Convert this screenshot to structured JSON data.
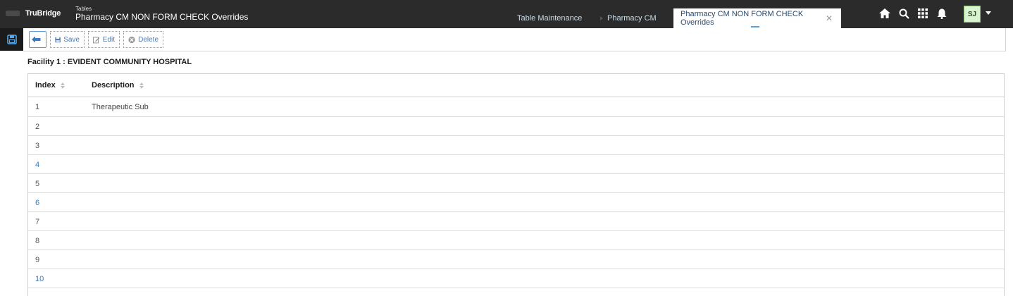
{
  "header": {
    "logo_text": "TruBridge",
    "subtitle": "Tables",
    "title": "Pharmacy CM NON FORM CHECK Overrides",
    "tabs": [
      {
        "label": "Table Maintenance"
      },
      {
        "label": "Pharmacy CM"
      },
      {
        "label": "Pharmacy CM NON FORM CHECK Overrides"
      }
    ],
    "avatar_initials": "SJ"
  },
  "toolbar": {
    "save_label": "Save",
    "edit_label": "Edit",
    "delete_label": "Delete"
  },
  "facility": {
    "label": "Facility 1 : EVIDENT COMMUNITY HOSPITAL"
  },
  "table": {
    "columns": [
      "Index",
      "Description"
    ],
    "rows": [
      {
        "index": "1",
        "description": "Therapeutic Sub"
      },
      {
        "index": "2",
        "description": ""
      },
      {
        "index": "3",
        "description": ""
      },
      {
        "index": "4",
        "description": ""
      },
      {
        "index": "5",
        "description": ""
      },
      {
        "index": "6",
        "description": ""
      },
      {
        "index": "7",
        "description": ""
      },
      {
        "index": "8",
        "description": ""
      },
      {
        "index": "9",
        "description": ""
      },
      {
        "index": "10",
        "description": ""
      }
    ]
  },
  "colors": {
    "header_bg": "#2b2b2b",
    "accent": "#4a7ab0",
    "avatar_bg": "#d9f2d0"
  }
}
